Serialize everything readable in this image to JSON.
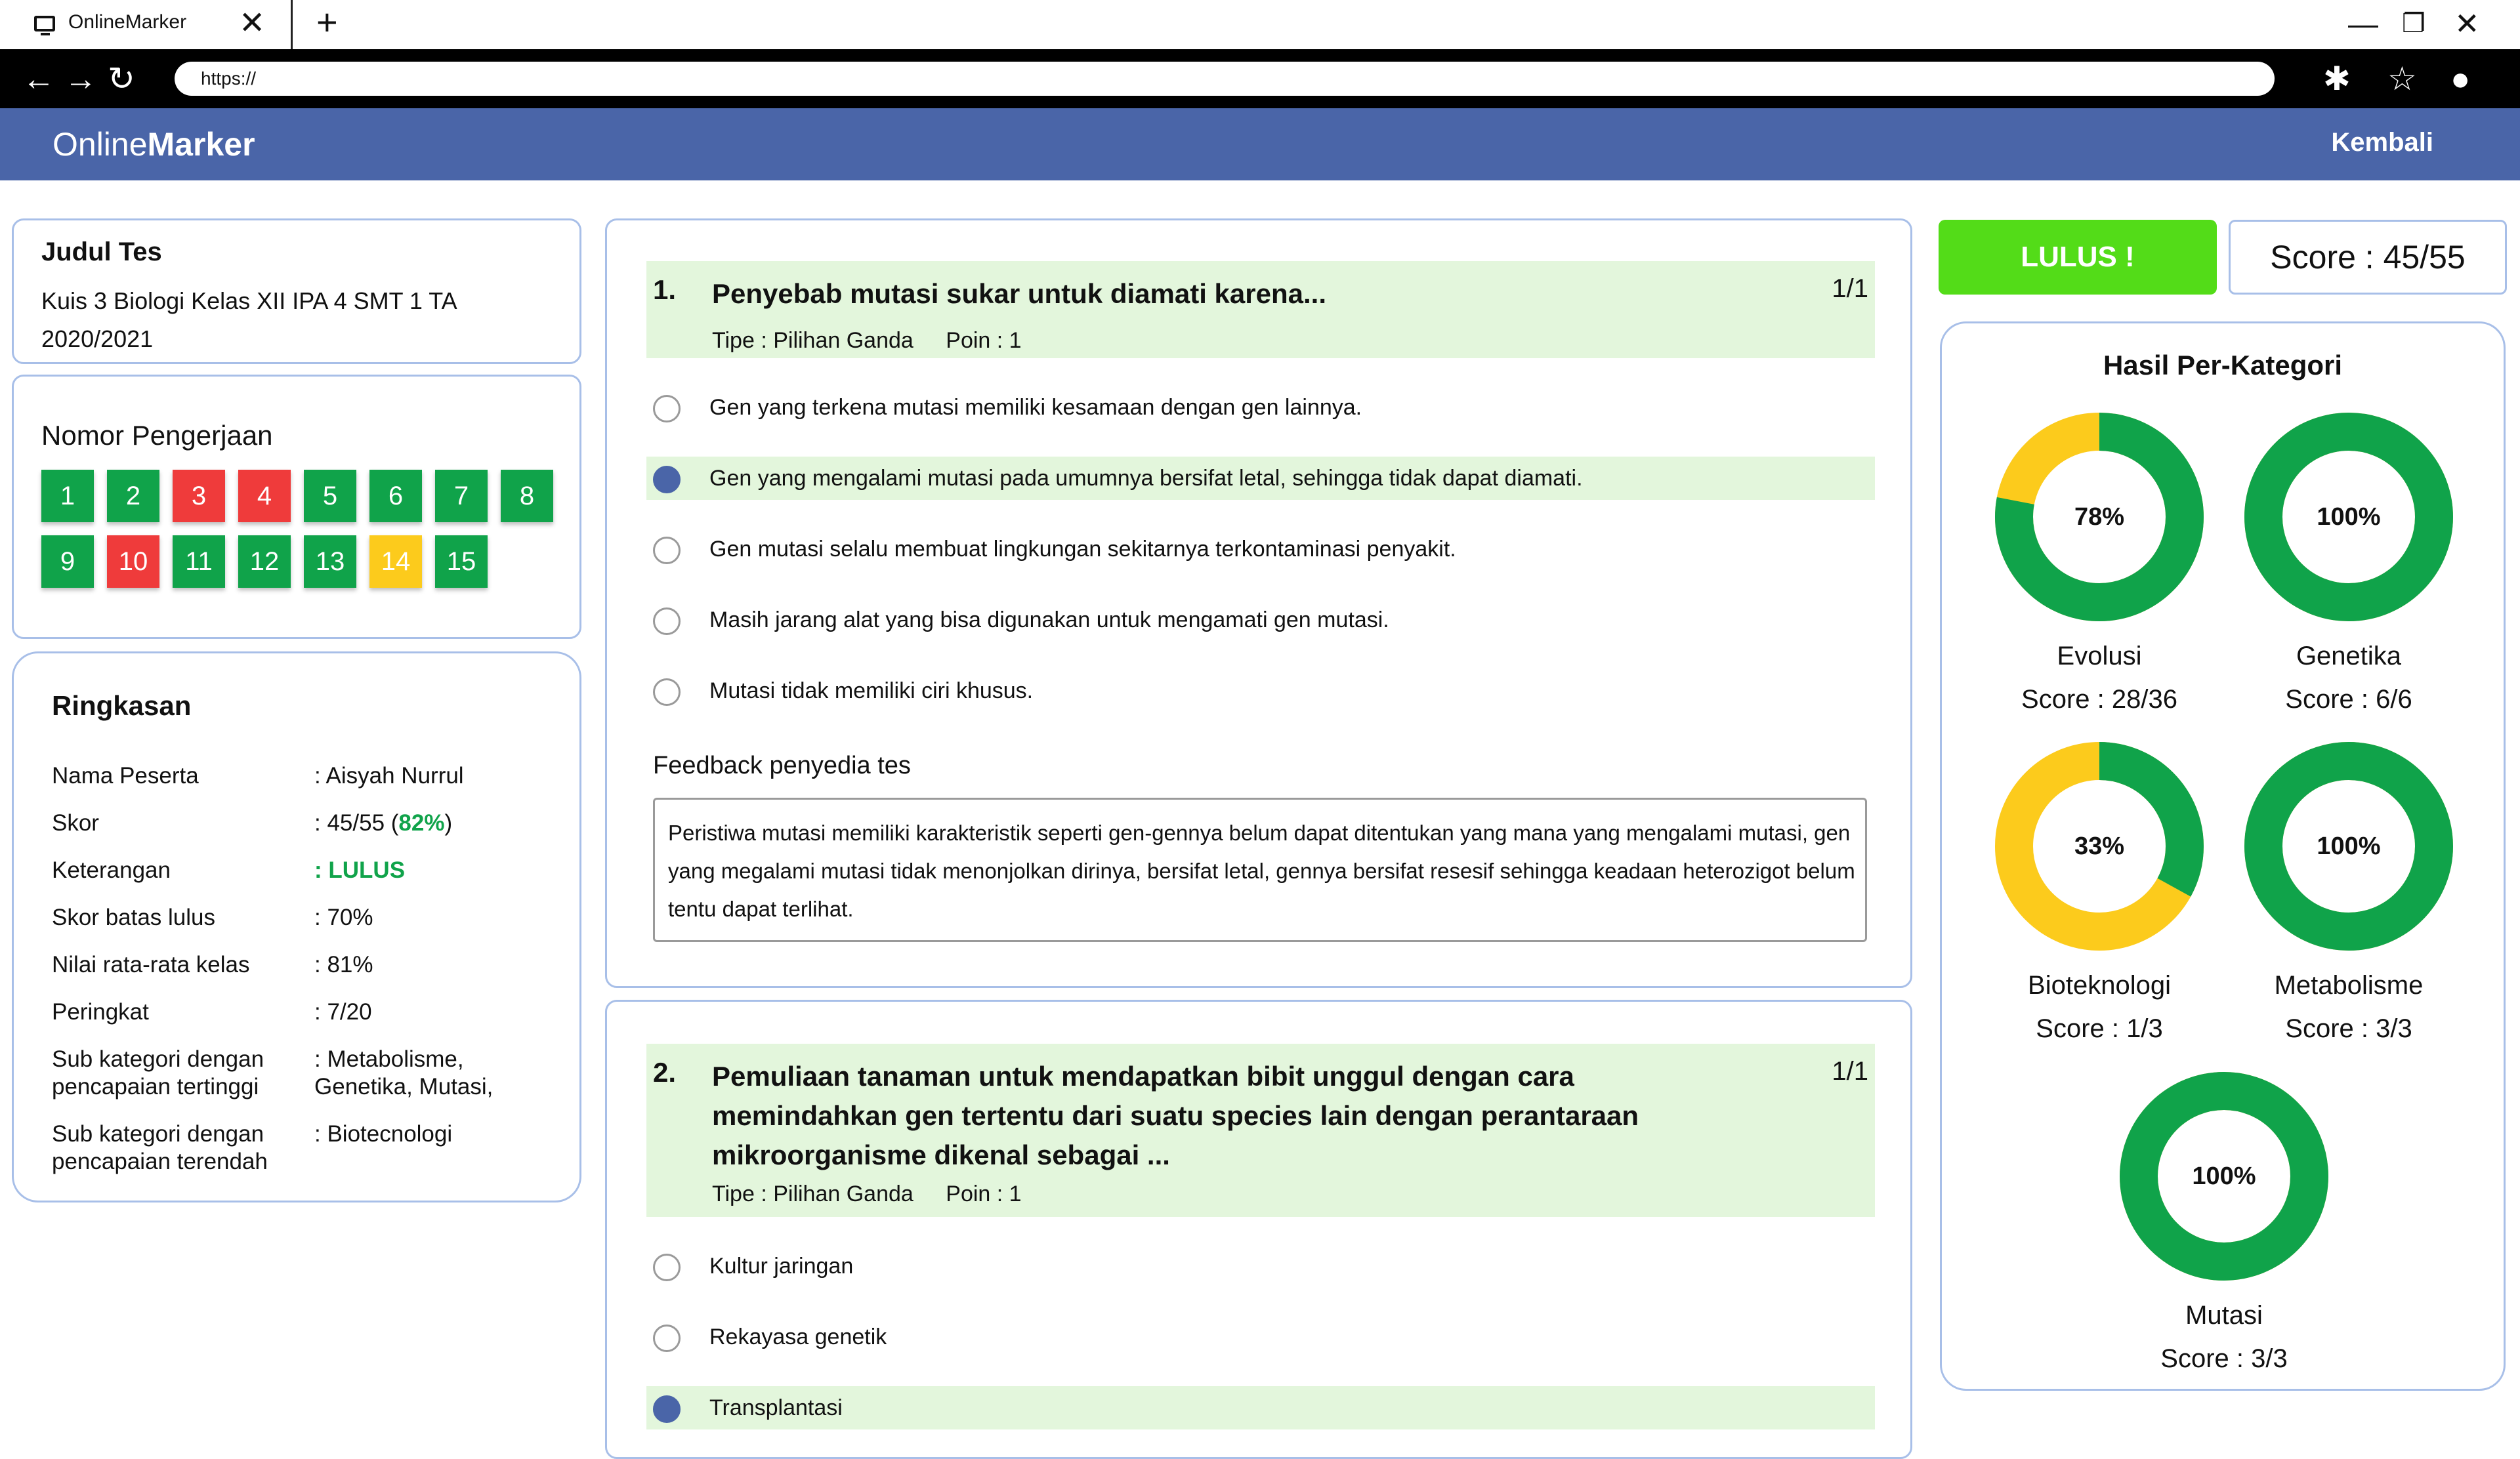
{
  "browser": {
    "tab_title": "OnlineMarker",
    "url": "https://",
    "close_tab": "✕",
    "new_tab": "+"
  },
  "app": {
    "logo_regular": "Online",
    "logo_bold": "Marker",
    "back_label": "Kembali"
  },
  "test": {
    "label": "Judul Tes",
    "name": "Kuis 3 Biologi Kelas XII IPA 4 SMT 1 TA 2020/2021"
  },
  "nomor": {
    "label": "Nomor Pengerjaan",
    "items": [
      {
        "n": "1",
        "status": "correct"
      },
      {
        "n": "2",
        "status": "correct"
      },
      {
        "n": "3",
        "status": "wrong"
      },
      {
        "n": "4",
        "status": "wrong"
      },
      {
        "n": "5",
        "status": "correct"
      },
      {
        "n": "6",
        "status": "correct"
      },
      {
        "n": "7",
        "status": "correct"
      },
      {
        "n": "8",
        "status": "correct"
      },
      {
        "n": "9",
        "status": "correct"
      },
      {
        "n": "10",
        "status": "wrong"
      },
      {
        "n": "11",
        "status": "correct"
      },
      {
        "n": "12",
        "status": "correct"
      },
      {
        "n": "13",
        "status": "correct"
      },
      {
        "n": "14",
        "status": "partial"
      },
      {
        "n": "15",
        "status": "correct"
      }
    ]
  },
  "summary": {
    "title": "Ringkasan",
    "rows": [
      {
        "key": "Nama Peserta",
        "value": ": Aisyah Nurrul"
      },
      {
        "key": "Skor",
        "value": ": 45/55 (",
        "highlight": "82%",
        "suffix": ")"
      },
      {
        "key": "Keterangan",
        "value": ": LULUS"
      },
      {
        "key": "Skor batas lulus",
        "value": ": 70%"
      },
      {
        "key": "Nilai rata-rata kelas",
        "value": ": 81%"
      },
      {
        "key": "Peringkat",
        "value": ": 7/20"
      },
      {
        "key": "Sub kategori dengan pencapaian tertinggi",
        "value": ": Metabolisme, Genetika, Mutasi,"
      },
      {
        "key": "Sub kategori dengan pencapaian terendah",
        "value": ": Biotecnologi"
      }
    ]
  },
  "questions": [
    {
      "number": "1.",
      "text": "Penyebab mutasi sukar untuk diamati karena...",
      "score": "1/1",
      "type": "Tipe : Pilihan Ganda",
      "points": "Poin : 1",
      "options": [
        "Gen yang terkena mutasi memiliki kesamaan dengan gen lainnya.",
        "Gen yang mengalami mutasi pada umumnya bersifat letal, sehingga tidak dapat diamati.",
        "Gen mutasi selalu membuat lingkungan sekitarnya terkontaminasi penyakit.",
        "Masih jarang alat yang bisa digunakan untuk mengamati gen mutasi.",
        "Mutasi tidak memiliki ciri khusus."
      ],
      "selected": 1,
      "feedback_label": "Feedback penyedia tes",
      "feedback": "Peristiwa mutasi memiliki karakteristik seperti gen-gennya belum dapat ditentukan yang mana yang mengalami mutasi, gen yang megalami mutasi tidak menonjolkan dirinya, bersifat letal, gennya bersifat resesif sehingga keadaan heterozigot belum tentu dapat terlihat."
    },
    {
      "number": "2.",
      "text": "Pemuliaan tanaman untuk mendapatkan bibit unggul dengan cara memindahkan gen tertentu dari suatu species lain dengan perantaraan mikroorganisme dikenal sebagai ...",
      "score": "1/1",
      "type": "Tipe : Pilihan Ganda",
      "points": "Poin : 1",
      "options": [
        "Kultur jaringan",
        "Rekayasa genetik",
        "Transplantasi"
      ],
      "selected": 2
    }
  ],
  "result": {
    "status": "LULUS !",
    "score": "Score : 45/55"
  },
  "categories": {
    "title": "Hasil Per-Kategori",
    "colors": {
      "achieved": "#10a34a",
      "missed": "#fccb1c"
    },
    "items": [
      {
        "name": "Evolusi",
        "percent_label": "78%",
        "fraction": 0.78,
        "score": "Score : 28/36"
      },
      {
        "name": "Genetika",
        "percent_label": "100%",
        "fraction": 1.0,
        "score": "Score : 6/6"
      },
      {
        "name": "Bioteknologi",
        "percent_label": "33%",
        "fraction": 0.33,
        "score": "Score : 1/3"
      },
      {
        "name": "Metabolisme",
        "percent_label": "100%",
        "fraction": 1.0,
        "score": "Score : 3/3"
      },
      {
        "name": "Mutasi",
        "percent_label": "100%",
        "fraction": 1.0,
        "score": "Score : 3/3"
      }
    ]
  }
}
